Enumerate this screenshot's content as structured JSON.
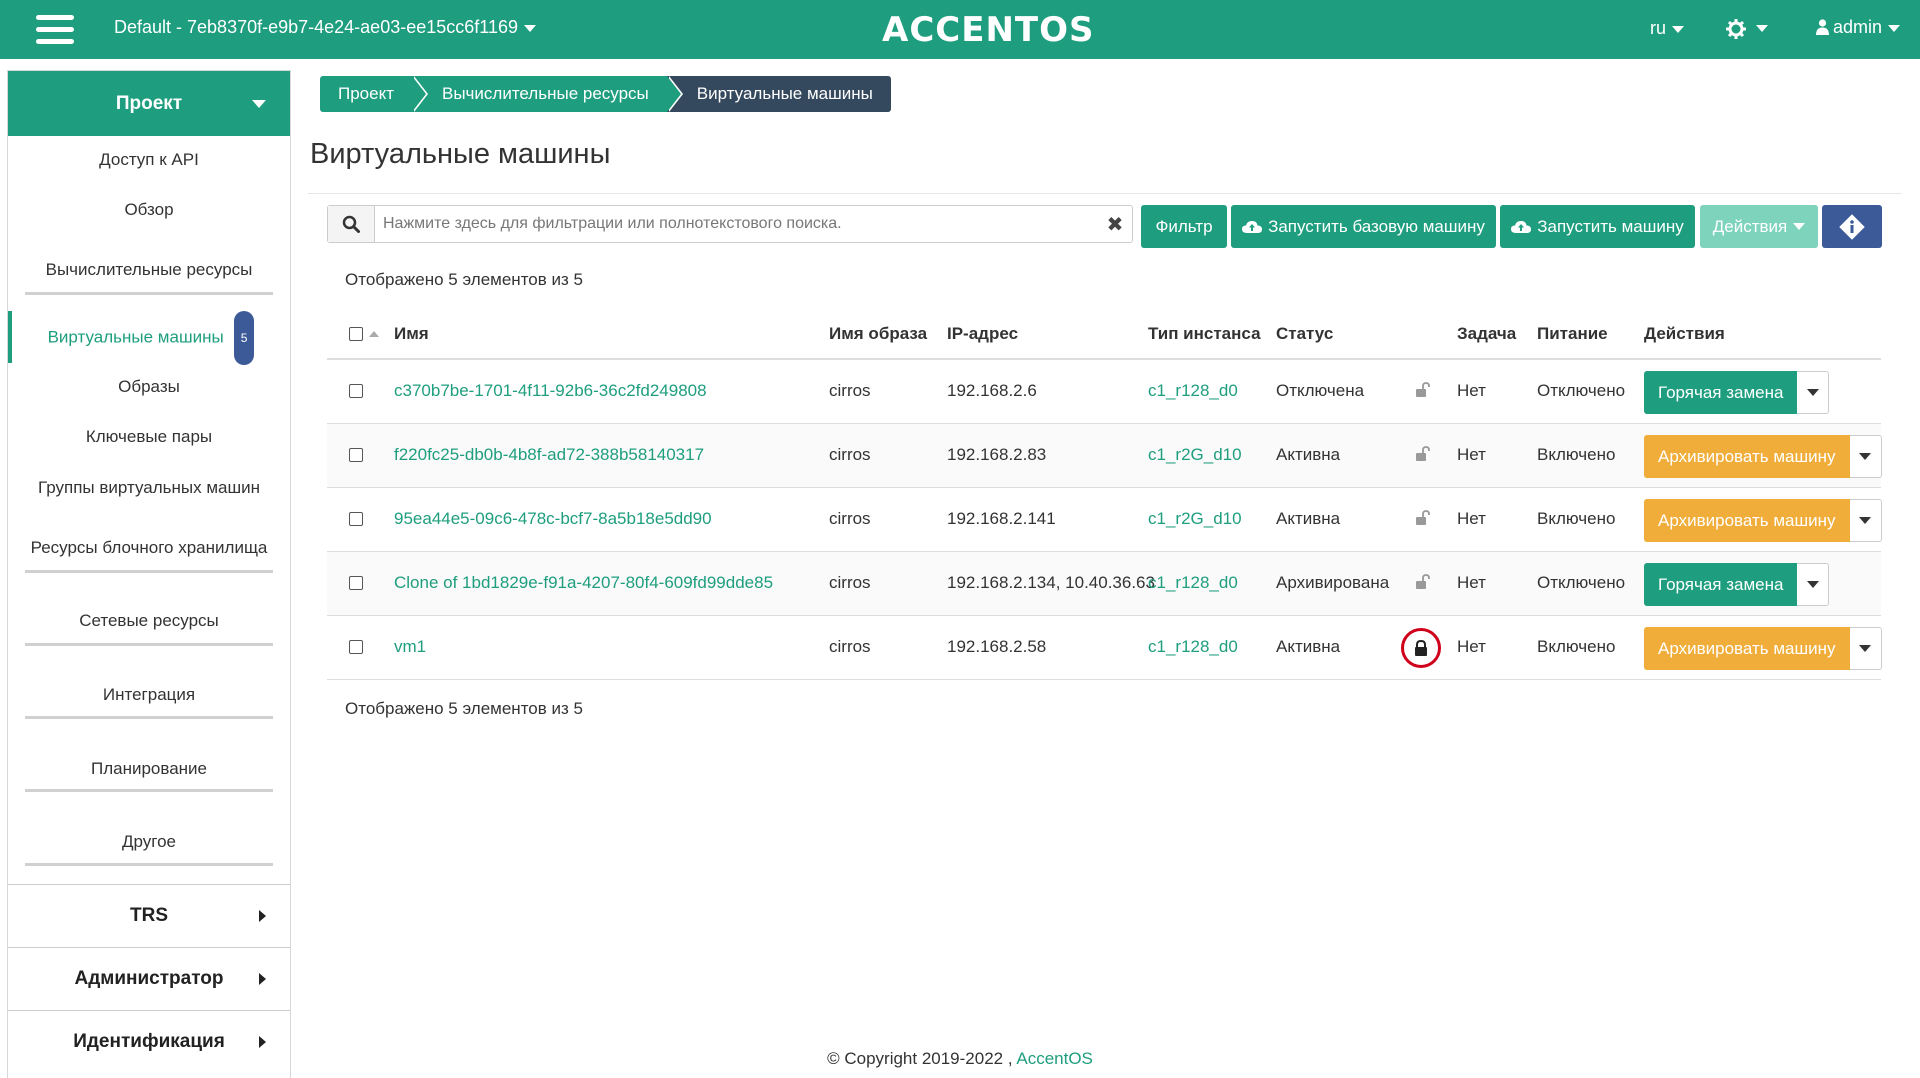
{
  "topbar": {
    "project": "Default - 7eb8370f-e9b7-4e24-ae03-ee15cc6f1169",
    "logo": "ACCENTOS",
    "lang": "ru",
    "user": "admin"
  },
  "sidebar": {
    "project_label": "Проект",
    "items": [
      {
        "label": "Доступ к API"
      },
      {
        "label": "Обзор"
      },
      {
        "label": "Вычислительные ресурсы"
      },
      {
        "label": "Виртуальные машины",
        "badge": "5",
        "active": true
      },
      {
        "label": "Образы"
      },
      {
        "label": "Ключевые пары"
      },
      {
        "label": "Группы виртуальных машин"
      },
      {
        "label": "Ресурсы блочного хранилища"
      },
      {
        "label": "Сетевые ресурсы"
      },
      {
        "label": "Интеграция"
      },
      {
        "label": "Планирование"
      },
      {
        "label": "Другое"
      }
    ],
    "groups": [
      {
        "label": "TRS"
      },
      {
        "label": "Администратор"
      },
      {
        "label": "Идентификация"
      }
    ]
  },
  "breadcrumb": [
    "Проект",
    "Вычислительные ресурсы",
    "Виртуальные машины"
  ],
  "page_title": "Виртуальные машины",
  "toolbar": {
    "search_placeholder": "Нажмите здесь для фильтрации или полнотекстового поиска.",
    "filter": "Фильтр",
    "launch_base": "Запустить базовую машину",
    "launch": "Запустить машину",
    "actions": "Действия"
  },
  "count_text": "Отображено 5 элементов из 5",
  "table": {
    "headers": {
      "name": "Имя",
      "image": "Имя образа",
      "ip": "IP-адрес",
      "flavor": "Тип инстанса",
      "status": "Статус",
      "task": "Задача",
      "power": "Питание",
      "actions": "Действия"
    },
    "rows": [
      {
        "name": "c370b7be-1701-4f11-92b6-36c2fd249808",
        "image": "cirros",
        "ip": "192.168.2.6",
        "flavor": "c1_r128_d0",
        "status": "Отключена",
        "locked": false,
        "task": "Нет",
        "power": "Отключено",
        "action": "Горячая замена",
        "action_type": "green"
      },
      {
        "name": "f220fc25-db0b-4b8f-ad72-388b58140317",
        "image": "cirros",
        "ip": "192.168.2.83",
        "flavor": "c1_r2G_d10",
        "status": "Активна",
        "locked": false,
        "task": "Нет",
        "power": "Включено",
        "action": "Архивировать машину",
        "action_type": "orange"
      },
      {
        "name": "95ea44e5-09c6-478c-bcf7-8a5b18e5dd90",
        "image": "cirros",
        "ip": "192.168.2.141",
        "flavor": "c1_r2G_d10",
        "status": "Активна",
        "locked": false,
        "task": "Нет",
        "power": "Включено",
        "action": "Архивировать машину",
        "action_type": "orange"
      },
      {
        "name": "Clone of 1bd1829e-f91a-4207-80f4-609fd99dde85",
        "image": "cirros",
        "ip": "192.168.2.134, 10.40.36.63",
        "flavor": "c1_r128_d0",
        "status": "Архивирована",
        "locked": false,
        "task": "Нет",
        "power": "Отключено",
        "action": "Горячая замена",
        "action_type": "green"
      },
      {
        "name": "vm1",
        "image": "cirros",
        "ip": "192.168.2.58",
        "flavor": "c1_r128_d0",
        "status": "Активна",
        "locked": true,
        "task": "Нет",
        "power": "Включено",
        "action": "Архивировать машину",
        "action_type": "orange"
      }
    ]
  },
  "footer": {
    "text": "© Copyright 2019-2022 , ",
    "link": "AccentOS"
  },
  "colors": {
    "brand": "#1e9e7e",
    "dark": "#34495e",
    "orange": "#f0ad3a",
    "info": "#3c5a98",
    "lock_ring": "#d0021b"
  }
}
